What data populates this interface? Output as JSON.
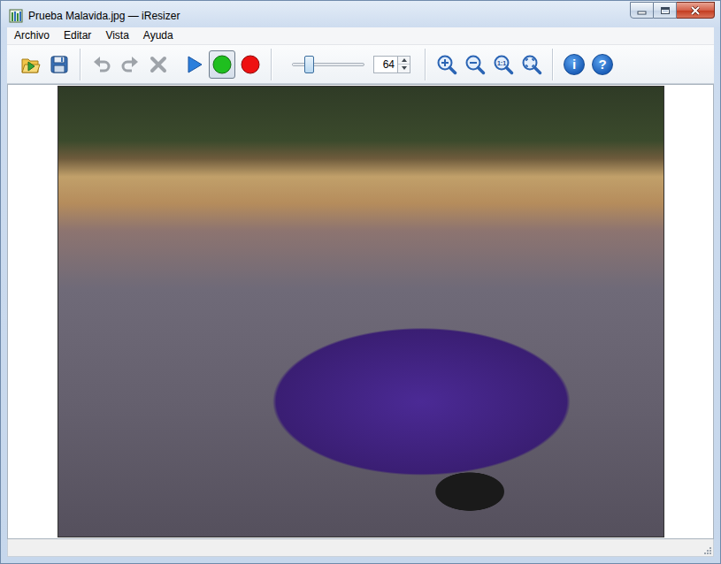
{
  "window": {
    "title": "Prueba Malavida.jpg — iResizer"
  },
  "menu": [
    {
      "label": "Archivo"
    },
    {
      "label": "Editar"
    },
    {
      "label": "Vista"
    },
    {
      "label": "Ayuda"
    }
  ],
  "edit_buttons": [
    {
      "disabled": true
    },
    {
      "disabled": true
    },
    {
      "disabled": true
    }
  ],
  "markers": [
    {
      "selected": true,
      "color": "#1fbf1f"
    },
    {
      "selected": false,
      "color": "#ee1111"
    }
  ],
  "brush": {
    "value": "64",
    "level": 0.23
  },
  "zoom": {
    "actual_label": "1:1"
  },
  "help_buttons": [
    {
      "label": "i"
    },
    {
      "label": "?"
    }
  ]
}
